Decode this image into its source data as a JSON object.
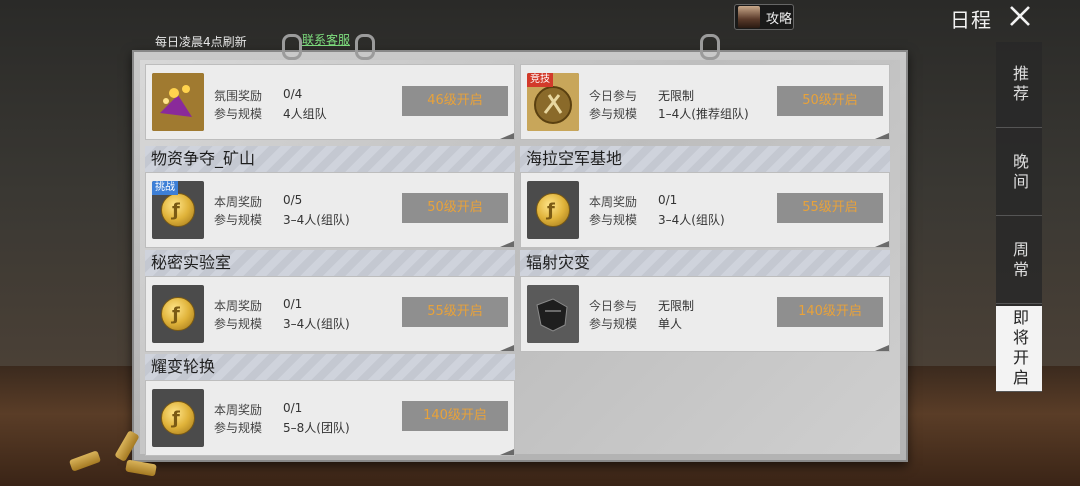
{
  "header": {
    "guide_label": "攻略",
    "title": "日程"
  },
  "board": {
    "refresh_text": "每日凌晨4点刷新",
    "service_link": "联系客服"
  },
  "tabs": [
    {
      "label": "推荐",
      "active": false
    },
    {
      "label": "晚间",
      "active": false
    },
    {
      "label": "周常",
      "active": false
    },
    {
      "label": "即将开启",
      "active": true
    }
  ],
  "cards": [
    {
      "title": "",
      "tag": "",
      "k1": "氛围奖励",
      "v1": "0/4",
      "k2": "参与规模",
      "v2": "4人组队",
      "level": "46级开启",
      "icon": "party-popper-icon"
    },
    {
      "title": "",
      "tag": "竞技",
      "k1": "今日参与",
      "v1": "无限制",
      "k2": "参与规模",
      "v2": "1–4人(推荐组队)",
      "level": "50级开启",
      "icon": "arena-coin-icon"
    },
    {
      "title": "物资争夺_矿山",
      "tag": "挑战",
      "k1": "本周奖励",
      "v1": "0/5",
      "k2": "参与规模",
      "v2": "3–4人(组队)",
      "level": "50级开启",
      "icon": "gold-coin-icon"
    },
    {
      "title": "海拉空军基地",
      "tag": "",
      "k1": "本周奖励",
      "v1": "0/1",
      "k2": "参与规模",
      "v2": "3–4人(组队)",
      "level": "55级开启",
      "icon": "gold-coin-icon"
    },
    {
      "title": "秘密实验室",
      "tag": "",
      "k1": "本周奖励",
      "v1": "0/1",
      "k2": "参与规模",
      "v2": "3–4人(组队)",
      "level": "55级开启",
      "icon": "gold-coin-icon"
    },
    {
      "title": "辐射灾变",
      "tag": "",
      "k1": "今日参与",
      "v1": "无限制",
      "k2": "参与规模",
      "v2": "单人",
      "level": "140级开启",
      "icon": "armor-icon"
    },
    {
      "title": "耀变轮换",
      "tag": "",
      "k1": "本周奖励",
      "v1": "0/1",
      "k2": "参与规模",
      "v2": "5–8人(团队)",
      "level": "140级开启",
      "icon": "gold-coin-icon"
    }
  ],
  "colors": {
    "level_text": "#e8a23a",
    "link": "#7fe07f"
  }
}
